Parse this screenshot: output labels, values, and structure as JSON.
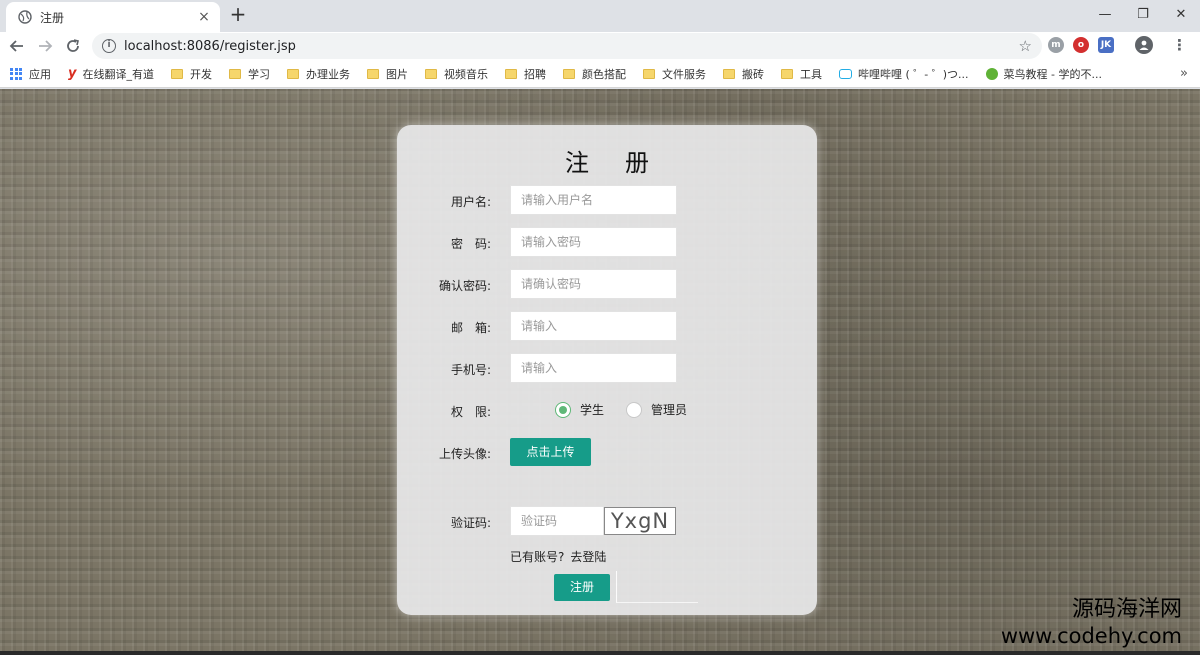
{
  "browser": {
    "tab": {
      "title": "注册",
      "close": "×"
    },
    "new_tab": "+",
    "window_controls": {
      "minimize": "—",
      "maximize": "❐",
      "close": "✕"
    },
    "address": {
      "url": "localhost:8086/register.jsp",
      "info": "i"
    },
    "extensions": [
      "m",
      "o",
      "JK"
    ],
    "bookmarks": [
      {
        "label": "应用",
        "icon": "apps-icon"
      },
      {
        "label": "在线翻译_有道",
        "icon": "youdao-icon"
      },
      {
        "label": "开发",
        "icon": "folder-icon"
      },
      {
        "label": "学习",
        "icon": "folder-icon"
      },
      {
        "label": "办理业务",
        "icon": "folder-icon"
      },
      {
        "label": "图片",
        "icon": "folder-icon"
      },
      {
        "label": "视频音乐",
        "icon": "folder-icon"
      },
      {
        "label": "招聘",
        "icon": "folder-icon"
      },
      {
        "label": "颜色搭配",
        "icon": "folder-icon"
      },
      {
        "label": "文件服务",
        "icon": "folder-icon"
      },
      {
        "label": "搬砖",
        "icon": "folder-icon"
      },
      {
        "label": "工具",
        "icon": "folder-icon"
      },
      {
        "label": "哔哩哔哩 ( ゜- ゜)つ...",
        "icon": "bilibili-icon"
      },
      {
        "label": "菜鸟教程 - 学的不...",
        "icon": "runoob-icon"
      }
    ],
    "bookmarks_more": "»"
  },
  "form": {
    "title": "注册",
    "fields": {
      "username": {
        "label": "用户名:",
        "placeholder": "请输入用户名"
      },
      "password": {
        "label": "密　码:",
        "placeholder": "请输入密码"
      },
      "confirm_password": {
        "label": "确认密码:",
        "placeholder": "请确认密码"
      },
      "email": {
        "label": "邮　箱:",
        "placeholder": "请输入"
      },
      "phone": {
        "label": "手机号:",
        "placeholder": "请输入"
      }
    },
    "role": {
      "label": "权　限:",
      "options": [
        {
          "label": "学生",
          "selected": true
        },
        {
          "label": "管理员",
          "selected": false
        }
      ]
    },
    "avatar": {
      "label": "上传头像:",
      "button": "点击上传"
    },
    "captcha": {
      "label": "验证码:",
      "placeholder": "验证码",
      "code": "YxgN"
    },
    "login_hint": {
      "text": "已有账号?",
      "link": "去登陆"
    },
    "submit": "注册"
  },
  "watermark": {
    "cn": "源码海洋网",
    "url": "www.codehy.com"
  },
  "colors": {
    "accent": "#169c89",
    "radio": "#5fb878",
    "card": "#e8e8ea"
  }
}
